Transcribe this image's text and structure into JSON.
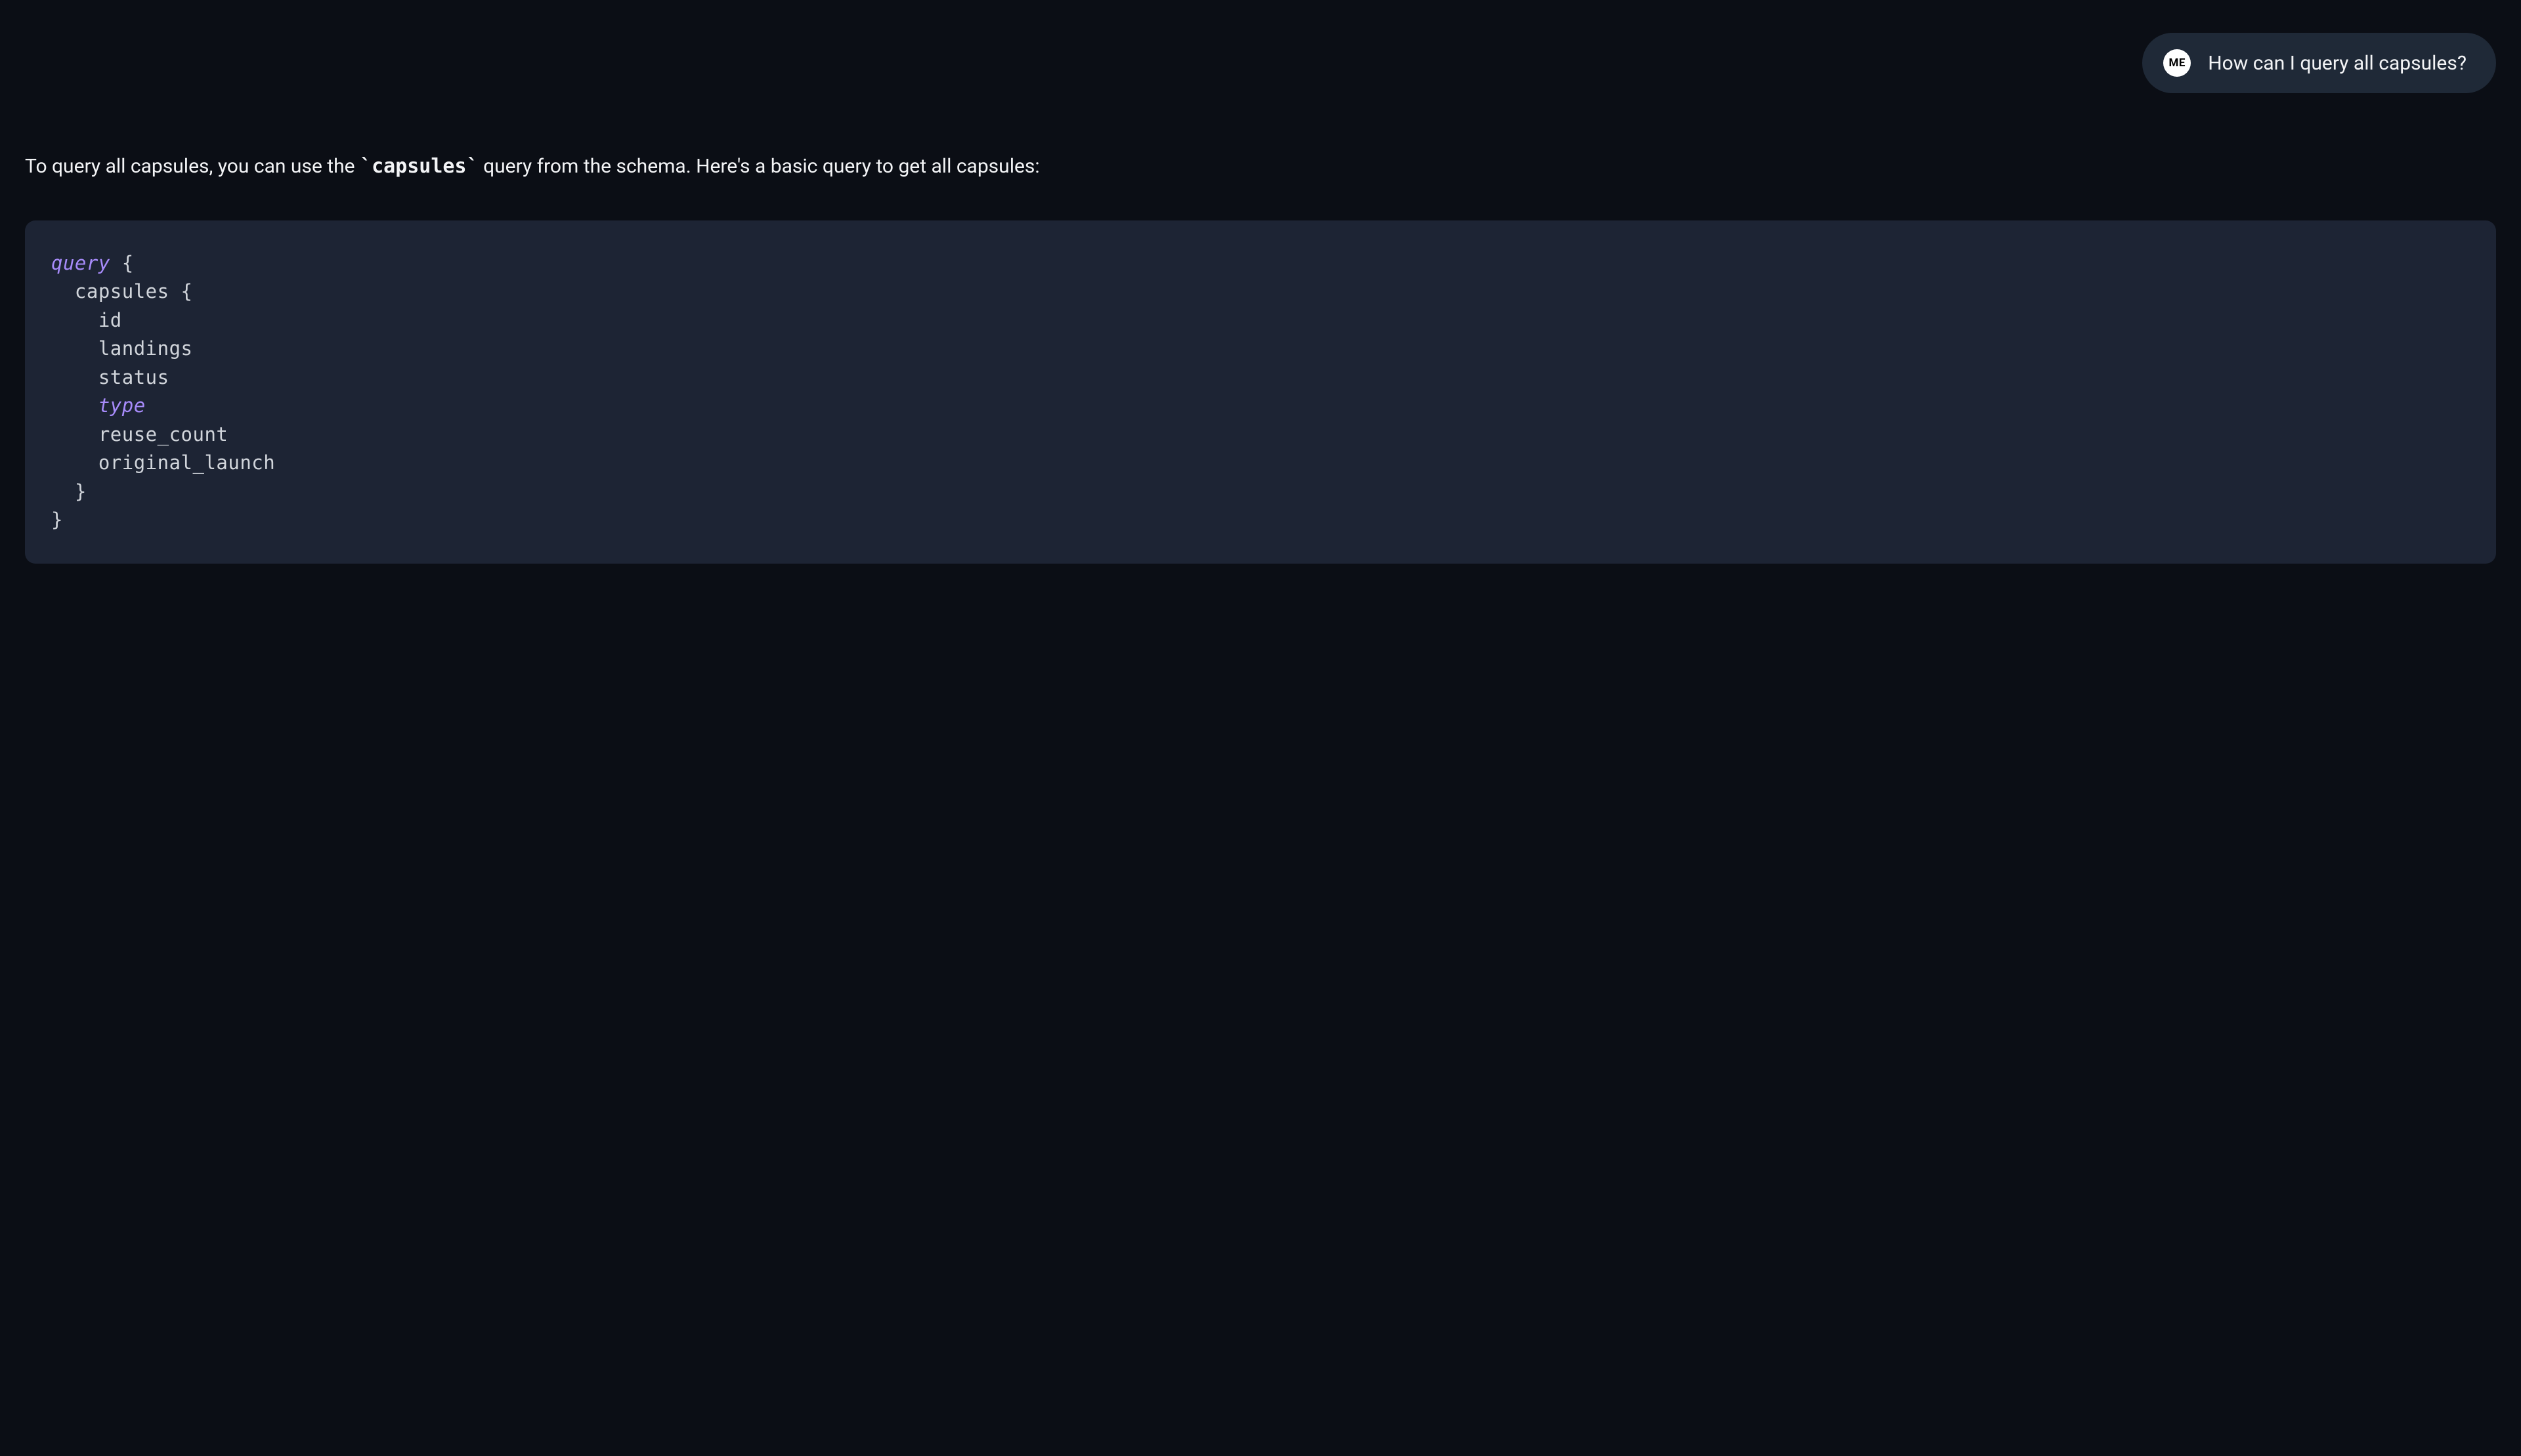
{
  "user_message": {
    "avatar_label": "ME",
    "text": "How can I query all capsules?"
  },
  "assistant": {
    "response_part1": "To query all capsules, you can use the ",
    "backtick1": "`",
    "code_inline": "capsules",
    "backtick2": "`",
    "response_part2": " query from the schema. Here's a basic query to get all capsules:"
  },
  "code": {
    "line1_kw": "query",
    "line1_rest": " {",
    "line2": "  capsules {",
    "line3": "    id",
    "line4": "    landings",
    "line5": "    status",
    "line6_indent": "    ",
    "line6_kw": "type",
    "line7": "    reuse_count",
    "line8": "    original_launch",
    "line9": "  }",
    "line10": "}"
  }
}
